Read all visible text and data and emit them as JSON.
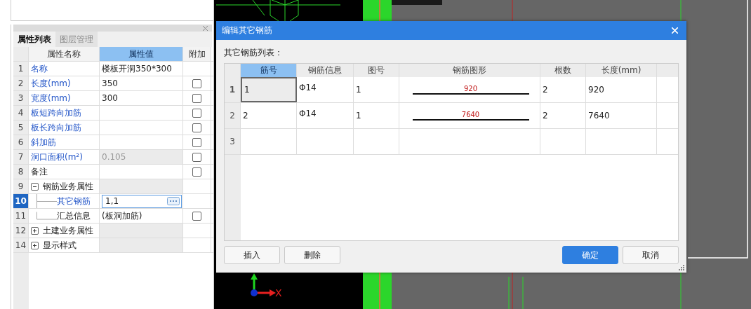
{
  "property_panel": {
    "tabs": [
      {
        "label": "属性列表",
        "selected": true
      },
      {
        "label": "图层管理",
        "selected": false
      }
    ],
    "columns": [
      {
        "label": "属性名称",
        "selected": false
      },
      {
        "label": "属性值",
        "selected": true
      },
      {
        "label": "附加",
        "selected": false
      }
    ],
    "rows": [
      {
        "num": "1",
        "name": "名称",
        "value": "楼板开洞350*300",
        "link": true,
        "disabled": false,
        "selected": false
      },
      {
        "num": "2",
        "name": "长度(mm)",
        "value": "350",
        "link": true,
        "disabled": false,
        "selected": false,
        "checked": false
      },
      {
        "num": "3",
        "name": "宽度(mm)",
        "value": "300",
        "link": true,
        "disabled": false,
        "selected": false,
        "checked": false
      },
      {
        "num": "4",
        "name": "板短跨向加筋",
        "value": "",
        "link": true,
        "disabled": false,
        "selected": false,
        "checked": false
      },
      {
        "num": "5",
        "name": "板长跨向加筋",
        "value": "",
        "link": true,
        "disabled": false,
        "selected": false,
        "checked": false
      },
      {
        "num": "6",
        "name": "斜加筋",
        "value": "",
        "link": true,
        "disabled": false,
        "selected": false,
        "checked": false
      },
      {
        "num": "7",
        "name": "洞口面积(m²)",
        "value": "0.105",
        "link": true,
        "disabled": true,
        "selected": false,
        "checked": false
      },
      {
        "num": "8",
        "name": "备注",
        "value": "",
        "link": false,
        "disabled": false,
        "selected": false,
        "checked": false
      },
      {
        "num": "9",
        "name": "钢筋业务属性",
        "kind": "group",
        "expanded": true,
        "selected": false,
        "children": [
          {
            "num": "10",
            "name": "其它钢筋",
            "value": "1,1",
            "link": true,
            "disabled": false,
            "selected": true
          },
          {
            "num": "11",
            "name": "汇总信息",
            "value": "(板洞加筋)",
            "link": false,
            "disabled": false,
            "selected": false,
            "checked": false
          }
        ]
      },
      {
        "num": "12",
        "name": "土建业务属性",
        "kind": "group",
        "expanded": false,
        "selected": false,
        "children": []
      },
      {
        "num": "14",
        "name": "显示样式",
        "kind": "group",
        "expanded": false,
        "selected": false,
        "children": []
      }
    ]
  },
  "canvas": {
    "axis_label": "X"
  },
  "dialog": {
    "title": "编辑其它钢筋",
    "list_label": "其它钢筋列表：",
    "columns": [
      {
        "label": "筋号",
        "selected": true
      },
      {
        "label": "钢筋信息",
        "selected": false
      },
      {
        "label": "图号",
        "selected": false
      },
      {
        "label": "钢筋图形",
        "selected": false
      },
      {
        "label": "根数",
        "selected": false
      },
      {
        "label": "长度(mm)",
        "selected": false
      }
    ],
    "rows": [
      {
        "num": "1",
        "selected": true,
        "bar_no": "1",
        "info": "Φ14",
        "fig": "1",
        "shape_label": "920",
        "count": "2",
        "length": "920"
      },
      {
        "num": "2",
        "selected": false,
        "bar_no": "2",
        "info": "Φ14",
        "fig": "1",
        "shape_label": "7640",
        "count": "2",
        "length": "7640"
      },
      {
        "num": "3",
        "selected": false,
        "bar_no": "",
        "info": "",
        "fig": "",
        "shape_label": "",
        "count": "",
        "length": ""
      }
    ],
    "left_buttons": [
      "插入",
      "删除"
    ],
    "ok": "确定",
    "cancel": "取消"
  }
}
